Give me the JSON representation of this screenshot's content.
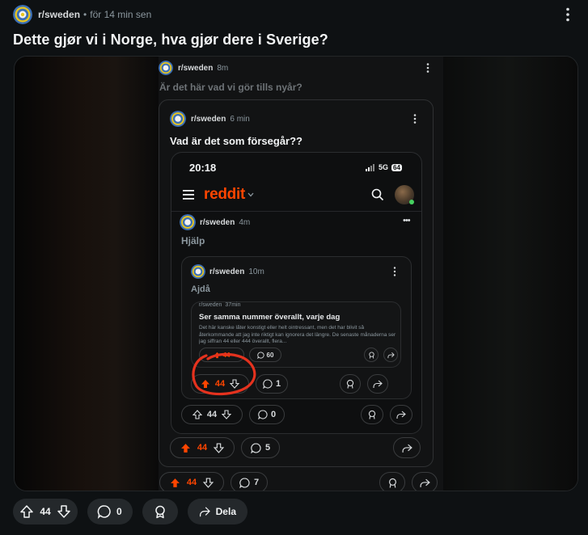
{
  "post": {
    "subreddit": "r/sweden",
    "separator": "•",
    "time": "för 14 min sen",
    "title": "Dette gjør vi i Norge, hva gjør dere i Sverige?",
    "actions": {
      "votes": "44",
      "comments": "0",
      "share_label": "Dela"
    }
  },
  "shot": {
    "level1": {
      "subreddit": "r/sweden",
      "time": "8m",
      "title": "Är det här vad vi gör tills nyår?",
      "votes": "44",
      "comments": "7"
    },
    "level2": {
      "subreddit": "r/sweden",
      "time": "6 min",
      "title": "Vad är det som försegår??",
      "votes": "44",
      "comments": "5"
    },
    "phone": {
      "clock": "20:18",
      "network": "5G",
      "battery": "64",
      "brand": "reddit",
      "level3": {
        "subreddit": "r/sweden",
        "time": "4m",
        "title": "Hjälp",
        "votes": "44",
        "comments": "0"
      },
      "level4": {
        "subreddit": "r/sweden",
        "time": "10m",
        "title": "Ajdå",
        "votes": "44",
        "comments": "1"
      },
      "level5": {
        "subreddit": "r/sweden",
        "time": "37min",
        "title": "Ser samma nummer överallt, varje dag",
        "body": "Det här kanske låter konstigt eller helt ointressant, men det har blivit så återkommande att jag inte riktigt kan ignorera det längre. De senaste månaderna ser jag siffran 44 eller 444 överallt, flera...",
        "votes": "44",
        "comments": "60"
      }
    }
  },
  "colors": {
    "accent": "#ff4500",
    "background": "#0e1113",
    "button": "#24282b"
  }
}
